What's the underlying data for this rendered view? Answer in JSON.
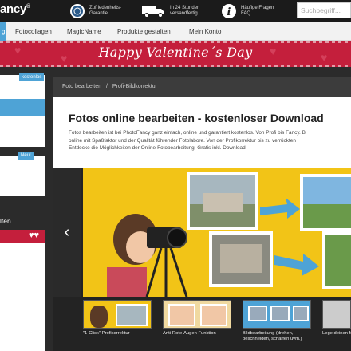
{
  "header": {
    "logo_text": "ancy",
    "logo_mark": "®",
    "badges": [
      {
        "icon": "award-seal-icon",
        "text": "Zufriedenheits-\nGarantie"
      },
      {
        "icon": "delivery-truck-icon",
        "text": "In 24 Stunden\nversandfertig"
      },
      {
        "icon": "info-icon",
        "text": "Häufige Fragen\nFAQ"
      }
    ],
    "search_placeholder": "Suchbegriff..."
  },
  "nav": {
    "items": [
      {
        "label": "g",
        "active": true
      },
      {
        "label": "Fotocollagen"
      },
      {
        "label": "MagicName"
      },
      {
        "label": "Produkte gestalten"
      },
      {
        "label": "Mein Konto"
      }
    ]
  },
  "banner": {
    "title": "Happy Valentine´s Day"
  },
  "sidebar": {
    "tag_top": "kostenlos",
    "tag_new": "Neu!",
    "label": "lten"
  },
  "breadcrumb": {
    "items": [
      "Foto bearbeiten",
      "/",
      "Profi-Bildkorrektur"
    ]
  },
  "main": {
    "title": "Fotos online bearbeiten - kostenloser Download",
    "intro_line1": "Fotos bearbeiten ist bei PhotoFancy ganz einfach, online und garantiert kostenlos. Von Profi bis Fancy. B",
    "intro_line2": "online mit Spaßfaktor und der Qualität führender Fotolabore. Von der Profikorrektur bis zu verrückten I",
    "intro_line3": "Entdecke die Möglichkeiten der Online-Fotobearbeitung. Gratis inkl. Download."
  },
  "slider": {
    "prev_icon": "chevron-left-icon",
    "thumbs": [
      {
        "caption": "\"1-Click\"-Profikorrektur"
      },
      {
        "caption": "Anti-Rote-Augen Funktion"
      },
      {
        "caption": "Bildbearbeitung (drehen, beschneiden, schärfen uvm.)"
      },
      {
        "caption": "Lege deinen fest"
      }
    ]
  },
  "colors": {
    "accent_blue": "#4ea3d6",
    "banner_red": "#c41f3c",
    "stage_yellow": "#f2c417",
    "dark": "#2b2b2b"
  }
}
